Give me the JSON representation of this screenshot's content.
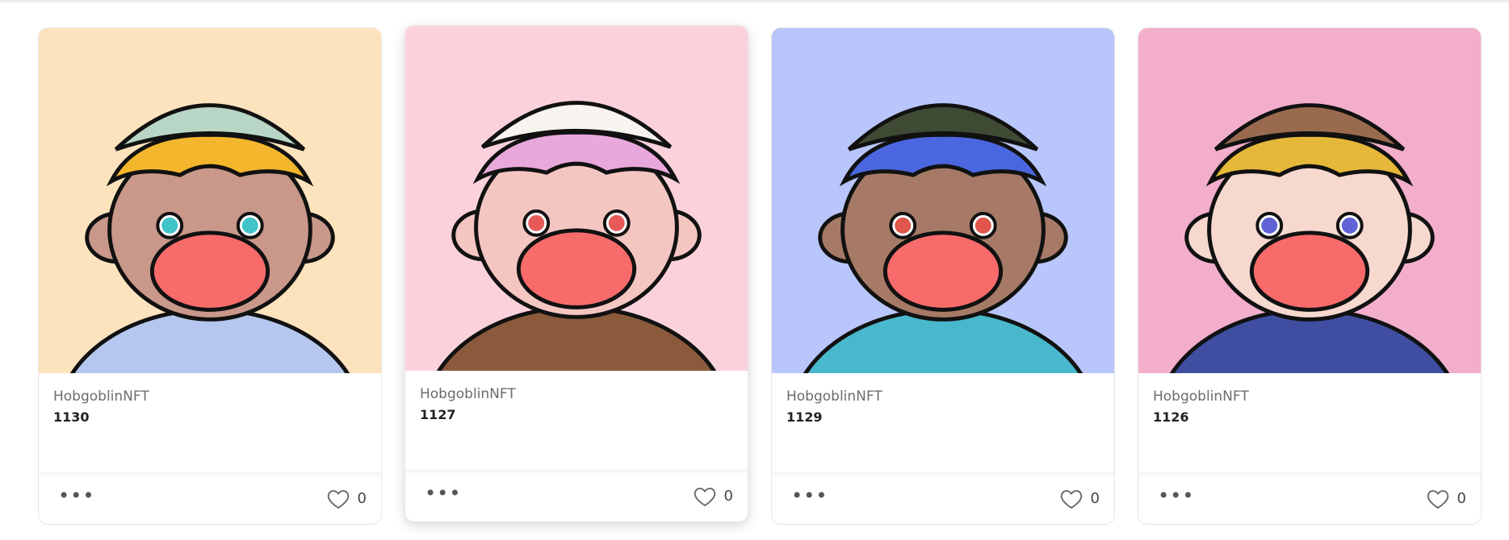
{
  "cards": [
    {
      "collection": "HobgoblinNFT",
      "token_id": "1130",
      "likes": "0",
      "more_label": "•••",
      "bg": "#fde3bd",
      "skin": "#c9988a",
      "hat": "#b8d6c5",
      "hair": "#f3b62c",
      "eyes": "#40c4c8",
      "shirt": "#b5c7ef"
    },
    {
      "collection": "HobgoblinNFT",
      "token_id": "1127",
      "likes": "0",
      "more_label": "•••",
      "bg": "#fbd2dc",
      "skin": "#f4c6c2",
      "hat": "#f7f3ee",
      "hair": "#e9a8dc",
      "eyes": "#e85a5a",
      "shirt": "#8b5a3c"
    },
    {
      "collection": "HobgoblinNFT",
      "token_id": "1129",
      "likes": "0",
      "more_label": "•••",
      "bg": "#b9c6fb",
      "skin": "#a67a66",
      "hat": "#3f4a35",
      "hair": "#4a67e0",
      "eyes": "#e0564c",
      "shirt": "#49b8cc"
    },
    {
      "collection": "HobgoblinNFT",
      "token_id": "1126",
      "likes": "0",
      "more_label": "•••",
      "bg": "#f2aeca",
      "skin": "#f6d8cf",
      "hat": "#9a6a4e",
      "hair": "#e6b83a",
      "eyes": "#5f63d6",
      "shirt": "#3f4ea0"
    }
  ],
  "colors": {
    "mouth": "#f76b6b",
    "outline": "#111111"
  }
}
